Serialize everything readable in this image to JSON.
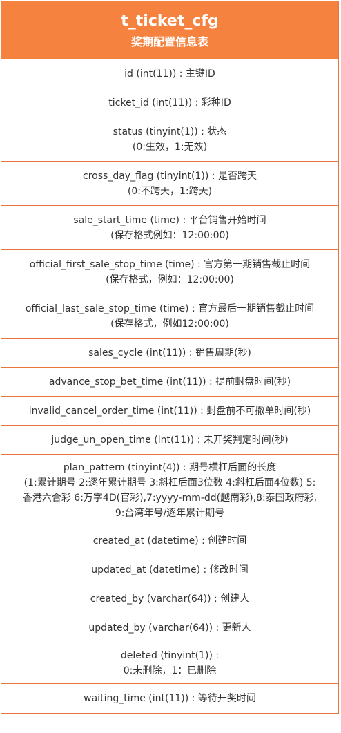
{
  "table": {
    "title": "t_ticket_cfg",
    "subtitle": "奖期配置信息表"
  },
  "fields": [
    {
      "lines": [
        "id (int(11)) : 主键ID"
      ]
    },
    {
      "lines": [
        "ticket_id (int(11)) : 彩种ID"
      ]
    },
    {
      "lines": [
        "status (tinyint(1)) : 状态",
        "(0:生效，1:无效)"
      ]
    },
    {
      "lines": [
        "cross_day_flag (tinyint(1)) : 是否跨天",
        "(0:不跨天，1:跨天)"
      ]
    },
    {
      "lines": [
        "sale_start_time (time) : 平台销售开始时间",
        "(保存格式例如：12:00:00)"
      ]
    },
    {
      "lines": [
        "official_first_sale_stop_time (time) : 官方第一期销售截止时间",
        "(保存格式，例如：12:00:00)"
      ]
    },
    {
      "lines": [
        "official_last_sale_stop_time (time) : 官方最后一期销售截止时间",
        "(保存格式，例如12:00:00)"
      ]
    },
    {
      "lines": [
        "sales_cycle (int(11)) : 销售周期(秒)"
      ]
    },
    {
      "lines": [
        "advance_stop_bet_time (int(11)) : 提前封盘时间(秒)"
      ]
    },
    {
      "lines": [
        "invalid_cancel_order_time (int(11)) : 封盘前不可撤单时间(秒)"
      ]
    },
    {
      "lines": [
        "judge_un_open_time (int(11)) : 未开奖判定时间(秒)"
      ]
    },
    {
      "lines": [
        "plan_pattern (tinyint(4)) : 期号横杠后面的长度",
        "(1:累计期号 2:逐年累计期号 3:斜杠后面3位数 4:斜杠后面4位数) 5:",
        "香港六合彩 6:万字4D(官彩),7:yyyy-mm-dd(越南彩),8:泰国政府彩,",
        "9:台湾年号/逐年累计期号"
      ]
    },
    {
      "lines": [
        "created_at (datetime) : 创建时间"
      ]
    },
    {
      "lines": [
        "updated_at (datetime) : 修改时间"
      ]
    },
    {
      "lines": [
        "created_by (varchar(64)) : 创建人"
      ]
    },
    {
      "lines": [
        "updated_by (varchar(64)) : 更新人"
      ]
    },
    {
      "lines": [
        "deleted (tinyint(1)) :",
        "0:未删除，1：已删除"
      ]
    },
    {
      "lines": [
        "waiting_time (int(11)) : 等待开奖时间"
      ]
    }
  ]
}
